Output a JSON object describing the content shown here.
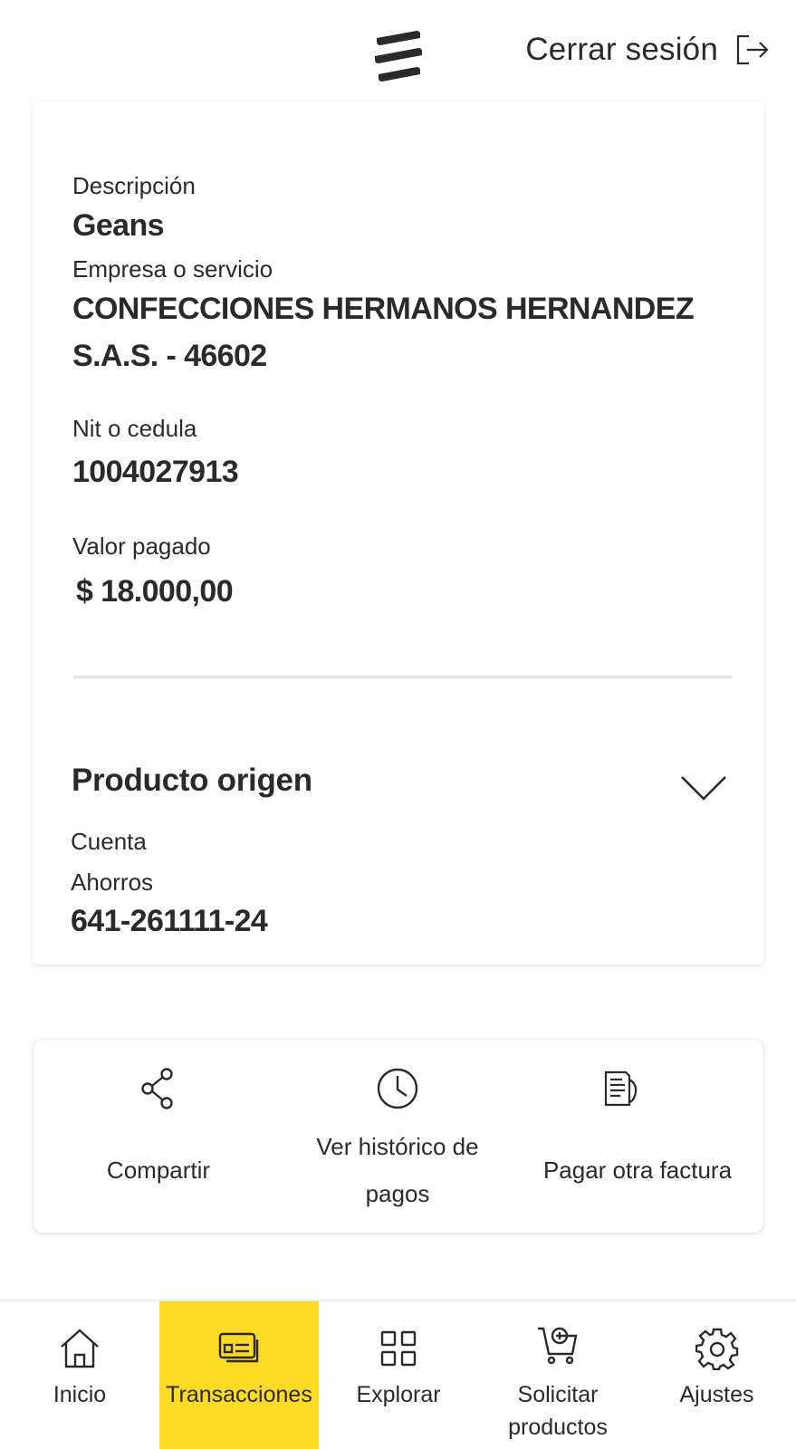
{
  "header": {
    "logout_label": "Cerrar sesión"
  },
  "detail": {
    "descripcion_label": "Descripción",
    "descripcion_value": "Geans",
    "empresa_label": "Empresa o servicio",
    "empresa_value_line1": "CONFECCIONES HERMANOS HERNANDEZ",
    "empresa_value_line2": "S.A.S. - 46602",
    "nit_label": "Nit o cedula",
    "nit_value": "1004027913",
    "valor_label": "Valor pagado",
    "valor_value": "$ 18.000,00"
  },
  "producto_origen": {
    "title": "Producto origen",
    "type_label": "Cuenta",
    "subtype_label": "Ahorros",
    "account_number": "641-261111-24"
  },
  "actions": [
    {
      "label": "Compartir",
      "icon": "share-icon"
    },
    {
      "label_line1": "Ver histórico de",
      "label_line2": "pagos",
      "icon": "clock-icon"
    },
    {
      "label": "Pagar otra factura",
      "icon": "bill-icon"
    }
  ],
  "nav": {
    "items": [
      {
        "label": "Inicio",
        "icon": "home-icon"
      },
      {
        "label": "Transacciones",
        "icon": "card-icon",
        "active": true
      },
      {
        "label": "Explorar",
        "icon": "grid-icon"
      },
      {
        "label_line1": "Solicitar",
        "label_line2": "productos",
        "icon": "cart-add-icon"
      },
      {
        "label": "Ajustes",
        "icon": "gear-icon"
      }
    ]
  },
  "colors": {
    "accent": "#fdda24",
    "text": "#2c2a29",
    "divider": "#e2e5e6"
  }
}
